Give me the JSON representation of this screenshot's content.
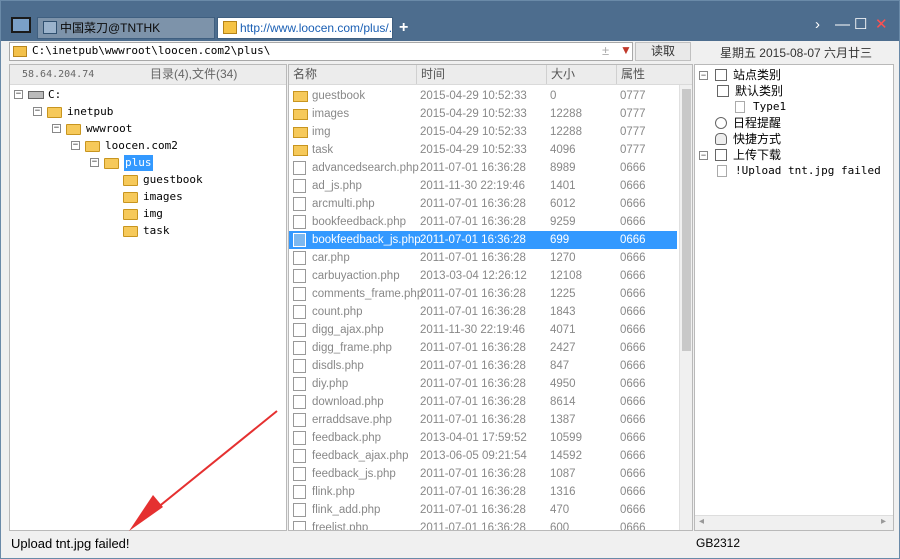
{
  "tabs": [
    {
      "label": "中国菜刀@TNTHK"
    },
    {
      "label": "http://www.loocen.com/plus/..."
    }
  ],
  "new_tab": "+",
  "window_controls": {
    "forward": "›",
    "minimize": "—",
    "maximize": "☐",
    "close": "✕"
  },
  "address": {
    "path": "C:\\inetpub\\wwwroot\\loocen.com2\\plus\\",
    "read_label": "读取"
  },
  "date_label": "星期五 2015-08-07 六月廿三",
  "left": {
    "ip": "58.64.204.74",
    "counts": "目录(4),文件(34)",
    "tree": [
      {
        "label": "C:",
        "level": 0,
        "kind": "drive"
      },
      {
        "label": "inetpub",
        "level": 1,
        "kind": "folder"
      },
      {
        "label": "wwwroot",
        "level": 2,
        "kind": "folder"
      },
      {
        "label": "loocen.com2",
        "level": 3,
        "kind": "folder"
      },
      {
        "label": "plus",
        "level": 4,
        "kind": "folder",
        "selected": true
      },
      {
        "label": "guestbook",
        "level": 5,
        "kind": "folder"
      },
      {
        "label": "images",
        "level": 5,
        "kind": "folder"
      },
      {
        "label": "img",
        "level": 5,
        "kind": "folder"
      },
      {
        "label": "task",
        "level": 5,
        "kind": "folder"
      }
    ]
  },
  "columns": {
    "name": "名称",
    "time": "时间",
    "size": "大小",
    "attr": "属性"
  },
  "files": [
    {
      "name": "guestbook",
      "time": "2015-04-29 10:52:33",
      "size": "0",
      "attr": "0777",
      "type": "folder"
    },
    {
      "name": "images",
      "time": "2015-04-29 10:52:33",
      "size": "12288",
      "attr": "0777",
      "type": "folder"
    },
    {
      "name": "img",
      "time": "2015-04-29 10:52:33",
      "size": "12288",
      "attr": "0777",
      "type": "folder"
    },
    {
      "name": "task",
      "time": "2015-04-29 10:52:33",
      "size": "4096",
      "attr": "0777",
      "type": "folder"
    },
    {
      "name": "advancedsearch.php",
      "time": "2011-07-01 16:36:28",
      "size": "8989",
      "attr": "0666",
      "type": "file"
    },
    {
      "name": "ad_js.php",
      "time": "2011-11-30 22:19:46",
      "size": "1401",
      "attr": "0666",
      "type": "file"
    },
    {
      "name": "arcmulti.php",
      "time": "2011-07-01 16:36:28",
      "size": "6012",
      "attr": "0666",
      "type": "file"
    },
    {
      "name": "bookfeedback.php",
      "time": "2011-07-01 16:36:28",
      "size": "9259",
      "attr": "0666",
      "type": "file"
    },
    {
      "name": "bookfeedback_js.php",
      "time": "2011-07-01 16:36:28",
      "size": "699",
      "attr": "0666",
      "type": "file",
      "selected": true
    },
    {
      "name": "car.php",
      "time": "2011-07-01 16:36:28",
      "size": "1270",
      "attr": "0666",
      "type": "file"
    },
    {
      "name": "carbuyaction.php",
      "time": "2013-03-04 12:26:12",
      "size": "12108",
      "attr": "0666",
      "type": "file"
    },
    {
      "name": "comments_frame.php",
      "time": "2011-07-01 16:36:28",
      "size": "1225",
      "attr": "0666",
      "type": "file"
    },
    {
      "name": "count.php",
      "time": "2011-07-01 16:36:28",
      "size": "1843",
      "attr": "0666",
      "type": "file"
    },
    {
      "name": "digg_ajax.php",
      "time": "2011-11-30 22:19:46",
      "size": "4071",
      "attr": "0666",
      "type": "file"
    },
    {
      "name": "digg_frame.php",
      "time": "2011-07-01 16:36:28",
      "size": "2427",
      "attr": "0666",
      "type": "file"
    },
    {
      "name": "disdls.php",
      "time": "2011-07-01 16:36:28",
      "size": "847",
      "attr": "0666",
      "type": "file"
    },
    {
      "name": "diy.php",
      "time": "2011-07-01 16:36:28",
      "size": "4950",
      "attr": "0666",
      "type": "file"
    },
    {
      "name": "download.php",
      "time": "2011-07-01 16:36:28",
      "size": "8614",
      "attr": "0666",
      "type": "file"
    },
    {
      "name": "erraddsave.php",
      "time": "2011-07-01 16:36:28",
      "size": "1387",
      "attr": "0666",
      "type": "file"
    },
    {
      "name": "feedback.php",
      "time": "2013-04-01 17:59:52",
      "size": "10599",
      "attr": "0666",
      "type": "file"
    },
    {
      "name": "feedback_ajax.php",
      "time": "2013-06-05 09:21:54",
      "size": "14592",
      "attr": "0666",
      "type": "file"
    },
    {
      "name": "feedback_js.php",
      "time": "2011-07-01 16:36:28",
      "size": "1087",
      "attr": "0666",
      "type": "file"
    },
    {
      "name": "flink.php",
      "time": "2011-07-01 16:36:28",
      "size": "1316",
      "attr": "0666",
      "type": "file"
    },
    {
      "name": "flink_add.php",
      "time": "2011-07-01 16:36:28",
      "size": "470",
      "attr": "0666",
      "type": "file"
    },
    {
      "name": "freelist.php",
      "time": "2011-07-01 16:36:28",
      "size": "600",
      "attr": "0666",
      "type": "file"
    }
  ],
  "right_tree": [
    {
      "label": "站点类别",
      "level": 0,
      "icon": "box"
    },
    {
      "label": "默认类别",
      "level": 1,
      "icon": "box"
    },
    {
      "label": "Type1",
      "level": 2,
      "icon": "page",
      "mono": true
    },
    {
      "label": "日程提醒",
      "level": 0,
      "icon": "clock"
    },
    {
      "label": "快捷方式",
      "level": 0,
      "icon": "hand"
    },
    {
      "label": "上传下载",
      "level": 0,
      "icon": "box"
    },
    {
      "label": "!Upload tnt.jpg failed",
      "level": 1,
      "icon": "page",
      "mono": true
    }
  ],
  "status": {
    "message": "Upload tnt.jpg failed!",
    "encoding": "GB2312"
  },
  "colors": {
    "titlebar": "#4d6d8e",
    "selection": "#3399ff",
    "annotation_arrow": "#e53030"
  }
}
